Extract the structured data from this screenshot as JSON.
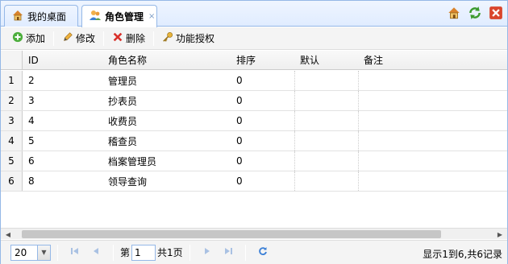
{
  "tabs": [
    {
      "label": "我的桌面",
      "icon": "home-icon"
    },
    {
      "label": "角色管理",
      "icon": "users-icon",
      "close": "×"
    }
  ],
  "tab_tools": [
    "home-icon",
    "refresh-icon",
    "close-icon"
  ],
  "toolbar": {
    "add_label": "添加",
    "edit_label": "修改",
    "delete_label": "删除",
    "grant_label": "功能授权"
  },
  "grid": {
    "columns": [
      "ID",
      "角色名称",
      "排序",
      "默认",
      "备注"
    ],
    "rows": [
      {
        "rownum": "1",
        "id": "2",
        "name": "管理员",
        "sort": "0",
        "default": "",
        "remark": ""
      },
      {
        "rownum": "2",
        "id": "3",
        "name": "抄表员",
        "sort": "0",
        "default": "",
        "remark": ""
      },
      {
        "rownum": "3",
        "id": "4",
        "name": "收费员",
        "sort": "0",
        "default": "",
        "remark": ""
      },
      {
        "rownum": "4",
        "id": "5",
        "name": "稽查员",
        "sort": "0",
        "default": "",
        "remark": ""
      },
      {
        "rownum": "5",
        "id": "6",
        "name": "档案管理员",
        "sort": "0",
        "default": "",
        "remark": ""
      },
      {
        "rownum": "6",
        "id": "8",
        "name": "领导查询",
        "sort": "0",
        "default": "",
        "remark": ""
      }
    ]
  },
  "pager": {
    "page_size": "20",
    "page_prefix": "第",
    "page_value": "1",
    "page_total": "共1页",
    "info": "显示1到6,共6记录"
  },
  "colors": {
    "border": "#95b8e7",
    "tab_bg": "#e0ecff"
  }
}
